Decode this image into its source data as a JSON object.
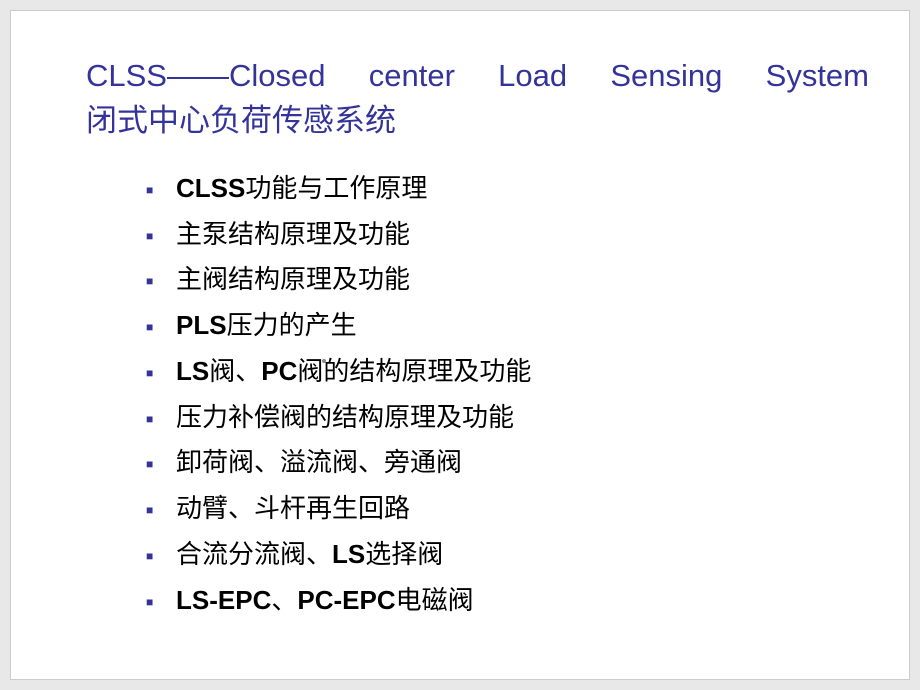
{
  "title": {
    "line1": "CLSS——Closed center Load Sensing System",
    "line2": "闭式中心负荷传感系统"
  },
  "bullets": [
    {
      "prefix_bold": "CLSS",
      "text": "功能与工作原理"
    },
    {
      "prefix_bold": "",
      "text": "主泵结构原理及功能"
    },
    {
      "prefix_bold": "",
      "text": "主阀结构原理及功能"
    },
    {
      "prefix_bold": "PLS",
      "text": "压力的产生"
    },
    {
      "prefix_bold": "LS",
      "text": "阀、",
      "mid_bold": "PC",
      "suffix": "阀的结构原理及功能"
    },
    {
      "prefix_bold": "",
      "text": "压力补偿阀的结构原理及功能"
    },
    {
      "prefix_bold": "",
      "text": "卸荷阀、溢流阀、旁通阀"
    },
    {
      "prefix_bold": "",
      "text": "动臂、斗杆再生回路"
    },
    {
      "prefix_bold": "",
      "text": "合流分流阀、",
      "mid_bold": "LS",
      "suffix": "选择阀"
    },
    {
      "prefix_bold": "LS-EPC",
      "text": "、",
      "mid_bold": "PC-EPC",
      "suffix": "电磁阀"
    }
  ]
}
